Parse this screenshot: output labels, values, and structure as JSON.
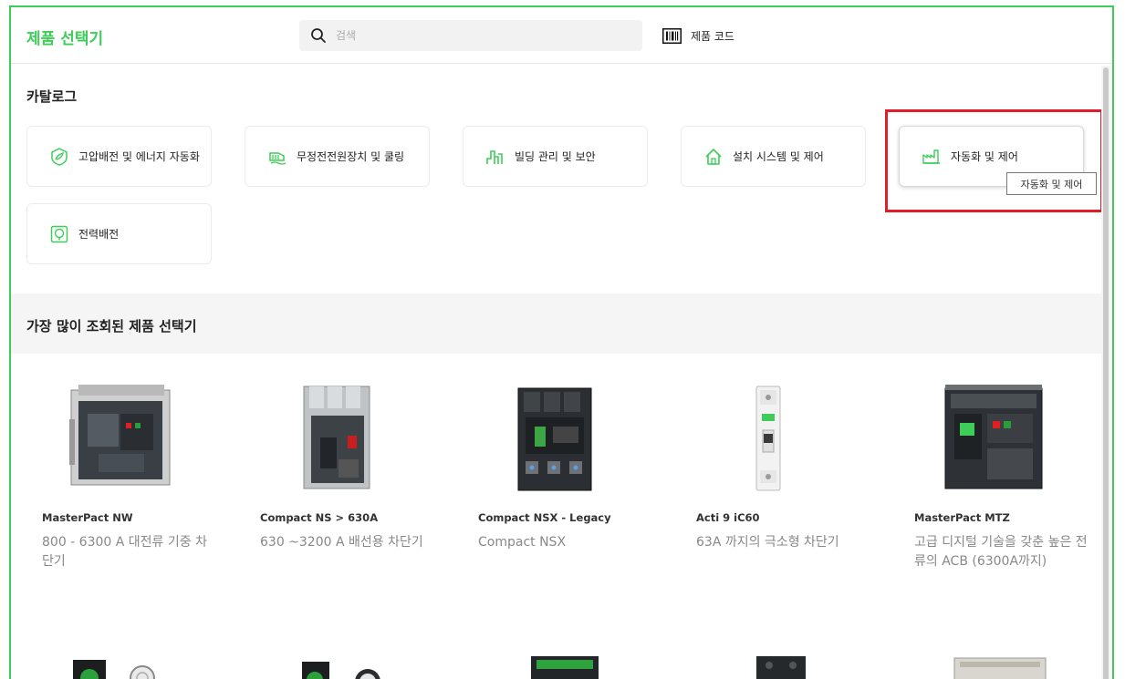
{
  "header": {
    "app_title": "제품 선택기",
    "search_placeholder": "검색",
    "product_code_label": "제품 코드"
  },
  "catalog": {
    "title": "카탈로그",
    "items": [
      {
        "label": "고압배전 및 에너지 자동화",
        "icon": "leaf-shield-icon"
      },
      {
        "label": "무정전전원장치 및 쿨링",
        "icon": "ups-cooling-icon"
      },
      {
        "label": "빌딩 관리 및 보안",
        "icon": "building-signal-icon"
      },
      {
        "label": "설치 시스템 및 제어",
        "icon": "house-icon"
      },
      {
        "label": "자동화 및 제어",
        "icon": "factory-icon"
      },
      {
        "label": "전력배전",
        "icon": "power-distribution-icon"
      }
    ],
    "tooltip": "자동화 및 제어"
  },
  "popular": {
    "title": "가장 많이 조회된 제품 선택기",
    "products": [
      {
        "name": "MasterPact NW",
        "desc": "800 - 6300 A 대전류 기중 차단기"
      },
      {
        "name": "Compact NS > 630A",
        "desc": "630 ~3200 A 배선용 차단기"
      },
      {
        "name": "Compact NSX - Legacy",
        "desc": "Compact NSX"
      },
      {
        "name": "Acti 9 iC60",
        "desc": "63A 까지의 극소형 차단기"
      },
      {
        "name": "MasterPact MTZ",
        "desc": "고급 디지털 기술을 갖춘 높은 전류의 ACB (6300A까지)"
      }
    ]
  },
  "colors": {
    "brand_green": "#3dcd58",
    "highlight_red": "#e11d2a"
  }
}
